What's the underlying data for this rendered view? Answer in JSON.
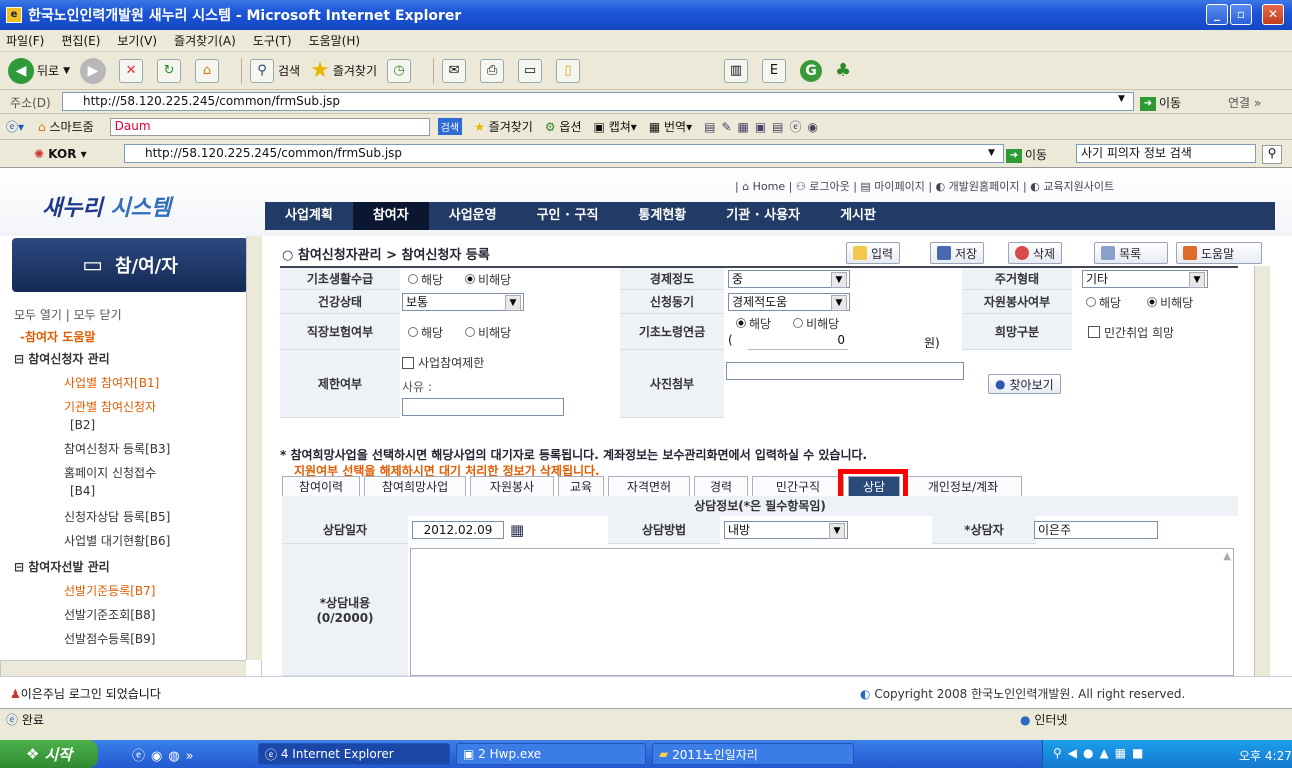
{
  "window": {
    "title": "한국노인인력개발원 새누리 시스템 - Microsoft Internet Explorer",
    "min": "_",
    "max": "▫",
    "close": "✕"
  },
  "menu": [
    "파일(F)",
    "편집(E)",
    "보기(V)",
    "즐겨찾기(A)",
    "도구(T)",
    "도움말(H)"
  ],
  "toolbar": {
    "back": "뒤로",
    "search": "검색",
    "favorites": "즐겨찾기"
  },
  "address": {
    "label": "주소(D)",
    "url": "http://58.120.225.245/common/frmSub.jsp",
    "go": "이동",
    "links": "연결 »"
  },
  "linkbar": {
    "smart": "스마트줌",
    "daum": "Daum",
    "search_btn": "검색",
    "favorites": "즐겨찾기",
    "options": "옵션",
    "capture": "캡쳐",
    "translate": "번역"
  },
  "kbar": {
    "lang": "KOR",
    "url": "http://58.120.225.245/common/frmSub.jsp",
    "go": "이동",
    "search": "사기 피의자 정보 검색"
  },
  "site": {
    "logo": "새누리",
    "logo2": "시스템",
    "util": "| ⌂ Home | ⚇ 로그아웃 | ▤ 마이페이지 | ◐ 개발원홈페이지 | ◐ 교육지원사이트",
    "nav": [
      "사업계획",
      "참여자",
      "사업운영",
      "구인 · 구직",
      "통계현황",
      "기관 · 사용자",
      "게시판"
    ]
  },
  "sidebar": {
    "head": "참/여/자",
    "toggle": "모두 열기 | 모두 닫기",
    "help": "-참여자 도움말",
    "g1": "⊟ 참여신청자 관리",
    "items": [
      "사업별 참여자[B1]",
      "기관별 참여신청자",
      "[B2]",
      "참여신청자 등록[B3]",
      "홈페이지 신청접수",
      "[B4]",
      "신청자상담 등록[B5]",
      "사업별 대기현황[B6]"
    ],
    "g2": "⊟ 참여자선발 관리",
    "items2": [
      "선발기준등록[B7]",
      "선발기준조회[B8]",
      "선발점수등록[B9]"
    ]
  },
  "content": {
    "breadcrumb": "참여신청자관리 > 참여신청자 등록",
    "buttons": {
      "input": "입력",
      "save": "저장",
      "delete": "삭제",
      "list": "목록",
      "help": "도움말"
    },
    "form": {
      "l_basic": "기초생활수급",
      "basic_o1": "해당",
      "basic_o2": "비해당",
      "l_econ": "경제정도",
      "econ_val": "중",
      "l_house": "주거형태",
      "house_val": "기타",
      "l_health": "건강상태",
      "health_val": "보통",
      "l_motive": "신청동기",
      "motive_val": "경제적도움",
      "l_volunteer": "자원봉사여부",
      "vol_o1": "해당",
      "vol_o2": "비해당",
      "l_insur": "직장보험여부",
      "ins_o1": "해당",
      "ins_o2": "비해당",
      "l_pension": "기초노령연금",
      "pen_o1": "해당",
      "pen_o2": "비해당",
      "pen_amt": "0",
      "pen_unit": "원)",
      "pen_open": "(",
      "l_hope": "희망구분",
      "hope_val": "민간취업 희망",
      "l_limit": "제한여부",
      "limit_chk": "사업참여제한",
      "reason": "사유 :",
      "l_photo": "사진첨부",
      "browse": "찾아보기"
    },
    "notice1": "* 참여희망사업을 선택하시면 해당사업의 대기자로 등록됩니다. 계좌정보는 보수관리화면에서 입력하실 수 있습니다.",
    "notice2": "지원여부 선택을 해제하시면 대기 처리한 정보가 삭제됩니다.",
    "tabs": [
      "참여이력",
      "참여희망사업",
      "자원봉사",
      "교육",
      "자격면허",
      "경력",
      "민간구직",
      "상담",
      "개인정보/계좌"
    ],
    "consult": {
      "title": "상담정보(*은 필수항목임)",
      "l_date": "상담일자",
      "date": "2012.02.09",
      "l_method": "상담방법",
      "method": "내방",
      "l_person": "*상담자",
      "person": "이은주",
      "l_content": "*상담내용",
      "count": "(0/2000)"
    }
  },
  "status": {
    "login": "이은주님 로그인 되었습니다",
    "copyright": "Copyright 2008 한국노인인력개발원. All right reserved.",
    "done": "완료",
    "zone": "인터넷"
  },
  "taskbar": {
    "start": "시작",
    "ie": "4 Internet Explorer",
    "hwp": "2 Hwp.exe",
    "folder": "2011노인일자리",
    "time": "오후 4:27"
  },
  "colors": {
    "highlight": "#ff0000",
    "nav": "#223a66",
    "accent": "#e25c00"
  }
}
